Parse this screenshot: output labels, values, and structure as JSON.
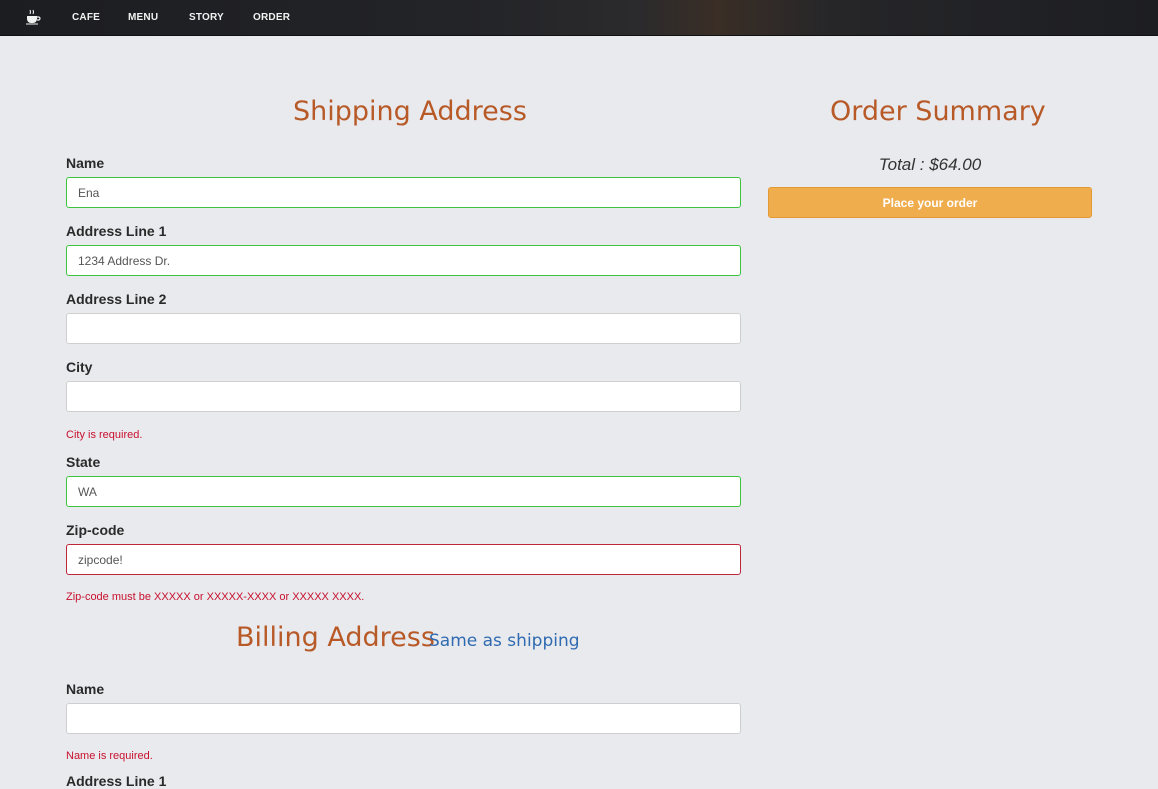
{
  "navbar": {
    "logo_icon": "coffee-cup-icon",
    "items": [
      "CAFE",
      "MENU",
      "STORY",
      "ORDER"
    ]
  },
  "shipping": {
    "title": "Shipping Address",
    "name_label": "Name",
    "name_value": "Ena",
    "address1_label": "Address Line 1",
    "address1_value": "1234 Address Dr.",
    "address2_label": "Address Line 2",
    "address2_value": "",
    "city_label": "City",
    "city_value": "",
    "city_error": "City is required.",
    "state_label": "State",
    "state_value": "WA",
    "zip_label": "Zip-code",
    "zip_value": "zipcode!",
    "zip_error": "Zip-code must be XXXXX or XXXXX-XXXX or XXXXX XXXX."
  },
  "billing": {
    "title": "Billing Address",
    "same_as_shipping_link": "Same as shipping",
    "name_label": "Name",
    "name_value": "",
    "name_error": "Name is required.",
    "address1_label": "Address Line 1"
  },
  "summary": {
    "title": "Order Summary",
    "total": "Total : $64.00",
    "place_order_label": "Place your order"
  },
  "colors": {
    "heading": "#b85a28",
    "link": "#2f6bb0",
    "error": "#c8102e",
    "valid_border": "#3cc43c",
    "invalid_border": "#c0263a",
    "order_button": "#f0ad4e"
  }
}
